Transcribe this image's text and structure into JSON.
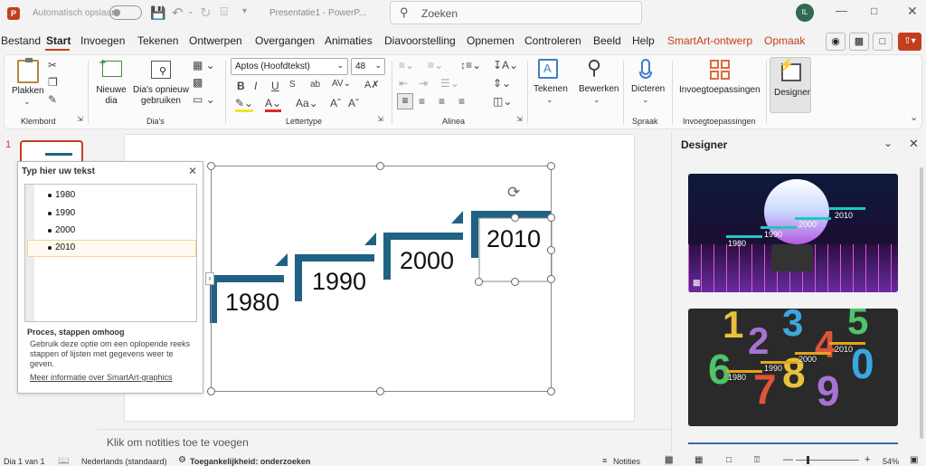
{
  "titlebar": {
    "autosave": "Automatisch opslaan",
    "doc_title": "Presentatie1 - PowerP...",
    "search_placeholder": "Zoeken",
    "user_initials": "IL"
  },
  "menu": {
    "items": [
      "Bestand",
      "Start",
      "Invoegen",
      "Tekenen",
      "Ontwerpen",
      "Overgangen",
      "Animaties",
      "Diavoorstelling",
      "Opnemen",
      "Controleren",
      "Beeld",
      "Help",
      "SmartArt-ontwerp",
      "Opmaak"
    ],
    "active": "Start",
    "accent_color": "#c43e1c"
  },
  "ribbon": {
    "clipboard": {
      "paste": "Plakken",
      "group": "Klembord"
    },
    "slides": {
      "new_slide": "Nieuwe dia",
      "reuse": "Dia's opnieuw gebruiken",
      "group": "Dia's"
    },
    "font": {
      "font_name": "Aptos (Hoofdtekst)",
      "font_size": "48",
      "group": "Lettertype"
    },
    "paragraph": {
      "group": "Alinea"
    },
    "drawing": {
      "draw": "Tekenen",
      "edit": "Bewerken"
    },
    "voice": {
      "dictate": "Dicteren",
      "group": "Spraak"
    },
    "addins": {
      "label": "Invoegtoepassingen",
      "group": "Invoegtoepassingen"
    },
    "designer": {
      "label": "Designer"
    }
  },
  "thumbnails": {
    "slide_number": "1"
  },
  "text_pane": {
    "title": "Typ hier uw tekst",
    "items": [
      "1980",
      "1990",
      "2000",
      "2010"
    ],
    "desc_title": "Proces, stappen omhoog",
    "desc_body": "Gebruik deze optie om een oplopende reeks stappen of lijsten met gegevens weer te geven.",
    "link": "Meer informatie over SmartArt-graphics"
  },
  "slide": {
    "steps": [
      "1980",
      "1990",
      "2000",
      "2010"
    ],
    "step_color": "#1f6283"
  },
  "notes": {
    "placeholder": "Klik om notities toe te voegen"
  },
  "designer_pane": {
    "title": "Designer",
    "card1": {
      "labels": [
        "1980",
        "1990",
        "2000",
        "2010"
      ]
    },
    "card2": {
      "labels": [
        "1980",
        "1990",
        "2000",
        "2010"
      ],
      "numbers": [
        "1",
        "2",
        "3",
        "4",
        "5",
        "6",
        "7",
        "8",
        "9",
        "0"
      ]
    }
  },
  "statusbar": {
    "slide_info": "Dia 1 van 1",
    "language": "Nederlands (standaard)",
    "accessibility": "Toegankelijkheid: onderzoeken",
    "notes": "Notities",
    "zoom": "54%"
  }
}
